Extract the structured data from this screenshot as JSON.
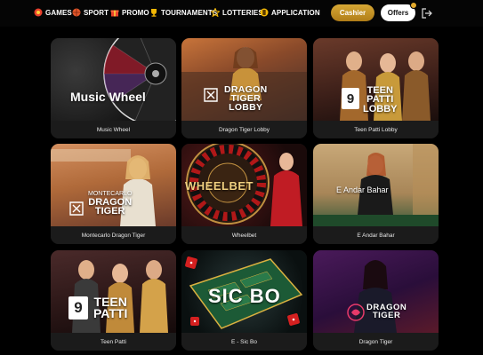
{
  "nav": {
    "items": [
      {
        "label": "GAMES",
        "icon": "games-icon"
      },
      {
        "label": "SPORT",
        "icon": "sport-ball-icon"
      },
      {
        "label": "PROMO",
        "icon": "promo-gift-icon"
      },
      {
        "label": "TOURNAMENTS",
        "icon": "tournaments-trophy-icon"
      },
      {
        "label": "LOTTERIES",
        "icon": "lotteries-star-icon"
      },
      {
        "label": "APPLICATION",
        "icon": "application-icon"
      }
    ],
    "cashier_label": "Cashier",
    "offers_label": "Offers",
    "logout_icon": "logout-icon"
  },
  "colors": {
    "background": "#000000",
    "card_caption_bg": "#1b1b1b",
    "cashier_gold": "#c9952a",
    "offers_bg": "#ffffff"
  },
  "games": [
    {
      "caption": "Music Wheel",
      "art": [
        "Music Wheel"
      ]
    },
    {
      "caption": "Dragon Tiger Lobby",
      "art": [
        "DRAGON",
        "TIGER",
        "LOBBY"
      ]
    },
    {
      "caption": "Teen Patti Lobby",
      "art": [
        "TEEN",
        "PATTI",
        "LOBBY"
      ]
    },
    {
      "caption": "Montecarlo Dragon Tiger",
      "art": [
        "MONTECARLO",
        "DRAGON",
        "TIGER"
      ]
    },
    {
      "caption": "Wheelbet",
      "art": [
        "WHEELBET"
      ]
    },
    {
      "caption": "E Andar Bahar",
      "art": [
        "E Andar Bahar"
      ]
    },
    {
      "caption": "Teen Patti",
      "art": [
        "TEEN",
        "PATTI"
      ]
    },
    {
      "caption": "E - Sic Bo",
      "art": [
        "SIC BO"
      ]
    },
    {
      "caption": "Dragon Tiger",
      "art": [
        "DRAGON",
        "TIGER"
      ]
    }
  ]
}
